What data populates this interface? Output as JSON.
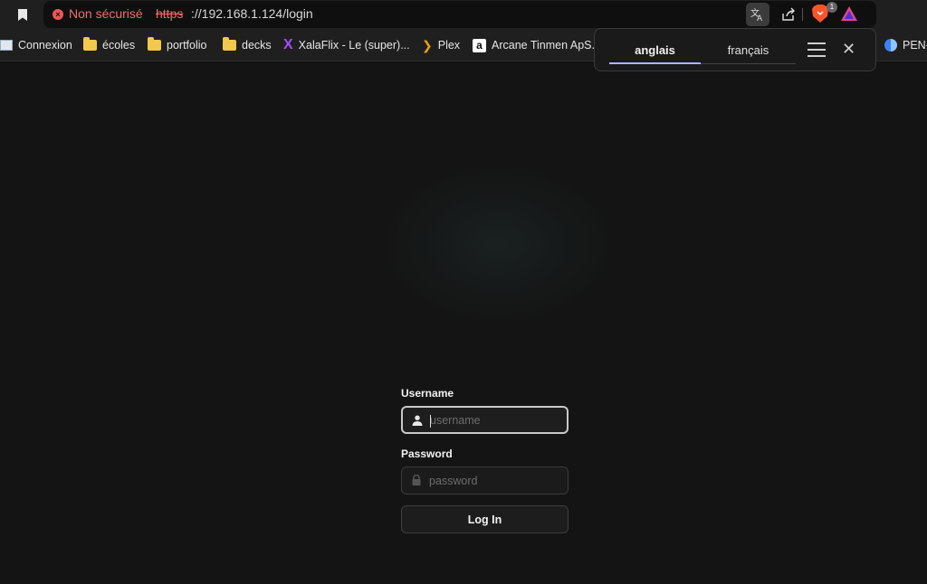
{
  "browser": {
    "security_text": "Non sécurisé",
    "url_scheme": "https",
    "url_rest": "://192.168.1.124/login",
    "brave_badge": "1"
  },
  "bookmarks": [
    {
      "label": "Connexion",
      "icon": "site-icon"
    },
    {
      "label": "écoles",
      "icon": "folder-icon"
    },
    {
      "label": "portfolio",
      "icon": "folder-icon"
    },
    {
      "label": "decks",
      "icon": "folder-icon"
    },
    {
      "label": "XalaFlix - Le (super)...",
      "icon": "xalaflix-icon"
    },
    {
      "label": "Plex",
      "icon": "plex-icon"
    },
    {
      "label": "Arcane Tinmen ApS...",
      "icon": "amazon-icon"
    },
    {
      "label": "PEN-",
      "icon": "pen-icon"
    }
  ],
  "translate_popup": {
    "tab_source": "anglais",
    "tab_target": "français"
  },
  "login": {
    "username_label": "Username",
    "username_placeholder": "username",
    "password_label": "Password",
    "password_placeholder": "password",
    "submit_label": "Log In"
  },
  "colors": {
    "background": "#141414",
    "insecure_red": "#f26c6c",
    "active_tab": "#a8b8ff"
  }
}
